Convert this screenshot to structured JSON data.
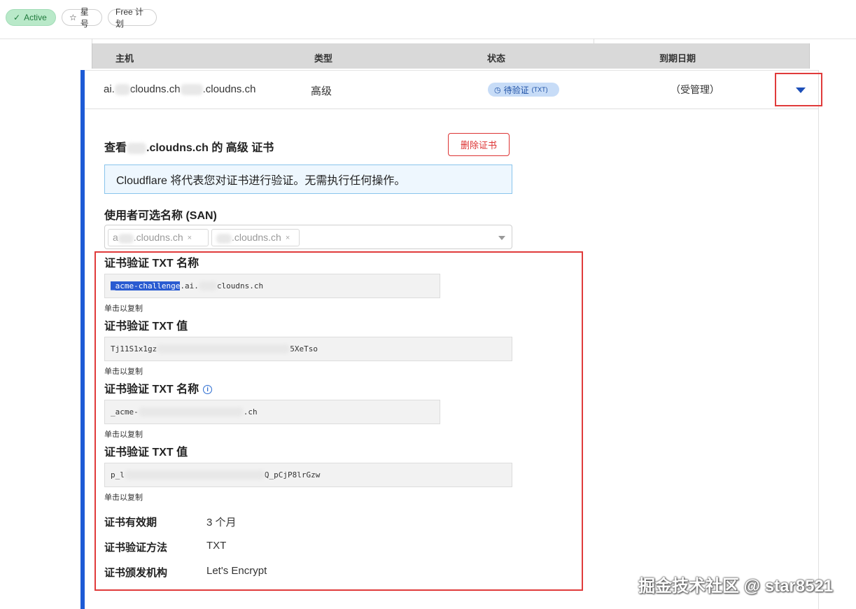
{
  "badges": {
    "active": "Active",
    "star": "星号",
    "plan": "Free 计划"
  },
  "table": {
    "headers": [
      "主机",
      "类型",
      "状态",
      "到期日期"
    ],
    "row": {
      "host_prefix": "ai.",
      "host_mid": "cloudns.ch",
      "host_suffix": ".cloudns.ch",
      "type": "高级",
      "status": "待验证",
      "status_tag": "(TXT)",
      "expiry": "（受管理）"
    }
  },
  "detail": {
    "title_prefix": "查看",
    "title_suffix": ".cloudns.ch 的 高级 证书",
    "delete_button": "删除证书",
    "info_message": "Cloudflare 将代表您对证书进行验证。无需执行任何操作。",
    "san_label": "使用者可选名称 (SAN)",
    "san_tags": [
      {
        "prefix": "a",
        "text": ".cloudns.ch"
      },
      {
        "prefix": "",
        "text": ".cloudns.ch"
      }
    ],
    "validations": [
      {
        "label": "证书验证 TXT 名称",
        "value_selected": "_acme-challenge",
        "value_rest": ".ai.",
        "value_tail": "cloudns.ch",
        "hint": "单击以复制"
      },
      {
        "label": "证书验证 TXT 值",
        "value_selected": "",
        "value_rest": "Tj11S1x1gz",
        "value_tail": "5XeTso",
        "hint": "单击以复制"
      },
      {
        "label": "证书验证 TXT 名称",
        "value_selected": "",
        "value_rest": "_acme-",
        "value_tail": ".ch",
        "hint": "单击以复制"
      },
      {
        "label": "证书验证 TXT 值",
        "value_selected": "",
        "value_rest": "p_l",
        "value_tail": "Q_pCjP8lrGzw",
        "hint": "单击以复制"
      }
    ],
    "properties": [
      {
        "key": "证书有效期",
        "value": "3 个月"
      },
      {
        "key": "证书验证方法",
        "value": "TXT"
      },
      {
        "key": "证书颁发机构",
        "value": "Let's Encrypt"
      }
    ]
  },
  "watermark": "掘金技术社区 @ star8521",
  "colors": {
    "accent_blue": "#1d5bd6",
    "danger_red": "#e03b3b",
    "active_green": "#b9e9c9",
    "pending_blue": "#c7dcf7"
  }
}
